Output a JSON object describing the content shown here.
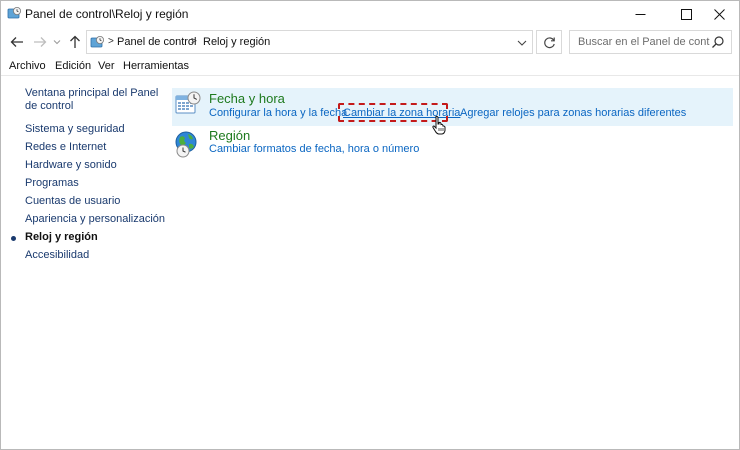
{
  "window": {
    "title": "Panel de control\\Reloj y región",
    "icons": {
      "app": "control-panel-icon",
      "minimize": "minimize-icon",
      "maximize": "maximize-icon",
      "close": "close-icon"
    }
  },
  "address_bar": {
    "crumbs": [
      "Panel de control",
      "Reloj y región"
    ],
    "separator": ">",
    "search_placeholder": "Buscar en el Panel de control"
  },
  "menu": {
    "items": [
      "Archivo",
      "Edición",
      "Ver",
      "Herramientas"
    ]
  },
  "sidebar": {
    "home": "Ventana principal del Panel de control",
    "items": [
      "Sistema y seguridad",
      "Redes e Internet",
      "Hardware y sonido",
      "Programas",
      "Cuentas de usuario",
      "Apariencia y personalización",
      "Reloj y región",
      "Accesibilidad"
    ],
    "active_index": 6
  },
  "categories": [
    {
      "title": "Fecha y hora",
      "icon": "calendar-clock-icon",
      "tasks": [
        "Configurar la hora y la fecha",
        "Cambiar la zona horaria",
        "Agregar relojes para zonas horarias diferentes"
      ]
    },
    {
      "title": "Región",
      "icon": "globe-clock-icon",
      "tasks": [
        "Cambiar formatos de fecha, hora o número"
      ]
    }
  ],
  "colors": {
    "link": "#0a66c2",
    "category_title": "#1e7a1e",
    "hover_bg": "#e5f3fb",
    "annotation": "#c41a1a"
  }
}
